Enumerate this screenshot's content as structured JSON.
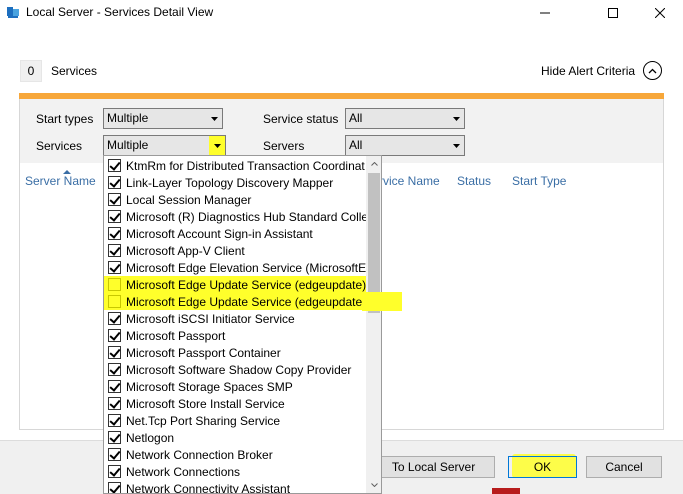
{
  "window": {
    "title": "Local Server - Services Detail View",
    "minimize_glyph": "—",
    "maximize_glyph": "☐",
    "close_glyph": "✕"
  },
  "header": {
    "count": "0",
    "count_label": "Services",
    "hide_alert_label": "Hide Alert Criteria"
  },
  "filters": {
    "start_types_label": "Start types",
    "start_types_value": "Multiple",
    "services_label": "Services",
    "services_value": "Multiple",
    "service_status_label": "Service status",
    "service_status_value": "All",
    "servers_label": "Servers",
    "servers_value": "All"
  },
  "table": {
    "columns": [
      "Server Name",
      "Service Name",
      "Status",
      "Start Type"
    ],
    "column_1_visible": "rvice Name"
  },
  "services_dropdown": {
    "items": [
      {
        "label": "KtmRm for Distributed Transaction Coordinat",
        "checked": true
      },
      {
        "label": "Link-Layer Topology Discovery Mapper",
        "checked": true
      },
      {
        "label": "Local Session Manager",
        "checked": true
      },
      {
        "label": "Microsoft (R) Diagnostics Hub Standard Colle",
        "checked": true
      },
      {
        "label": "Microsoft Account Sign-in Assistant",
        "checked": true
      },
      {
        "label": "Microsoft App-V Client",
        "checked": true
      },
      {
        "label": "Microsoft Edge Elevation Service (MicrosoftEc",
        "checked": true
      },
      {
        "label": "Microsoft Edge Update Service (edgeupdate)",
        "checked": false
      },
      {
        "label": "Microsoft Edge Update Service (edgeupdaten",
        "checked": false
      },
      {
        "label": "Microsoft iSCSI Initiator Service",
        "checked": true
      },
      {
        "label": "Microsoft Passport",
        "checked": true
      },
      {
        "label": "Microsoft Passport Container",
        "checked": true
      },
      {
        "label": "Microsoft Software Shadow Copy Provider",
        "checked": true
      },
      {
        "label": "Microsoft Storage Spaces SMP",
        "checked": true
      },
      {
        "label": "Microsoft Store Install Service",
        "checked": true
      },
      {
        "label": "Net.Tcp Port Sharing Service",
        "checked": true
      },
      {
        "label": "Netlogon",
        "checked": true
      },
      {
        "label": "Network Connection Broker",
        "checked": true
      },
      {
        "label": "Network Connections",
        "checked": true
      },
      {
        "label": "Network Connectivity Assistant",
        "checked": true
      }
    ]
  },
  "footer": {
    "local_label": "To Local Server",
    "ok_label": "OK",
    "cancel_label": "Cancel"
  },
  "colors": {
    "accent": "#f7a73a",
    "highlight": "#ffff2b",
    "header_link": "#3a6ea5"
  }
}
